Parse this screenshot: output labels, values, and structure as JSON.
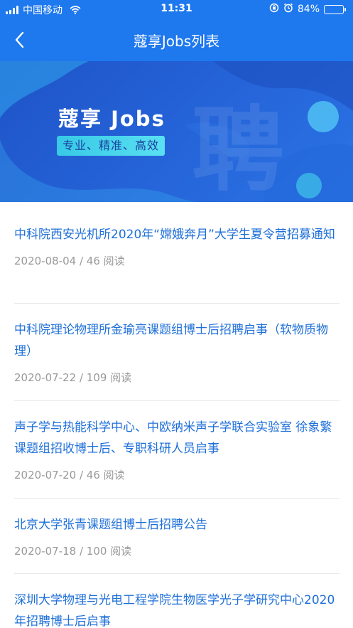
{
  "status_bar": {
    "carrier": "中国移动",
    "time": "11:31",
    "battery_percent": "84%",
    "battery_level": 0.84,
    "icons": [
      "signal-icon",
      "wifi-icon",
      "orientation-lock-icon",
      "alarm-icon",
      "battery-icon"
    ]
  },
  "nav": {
    "title": "蔻享Jobs列表",
    "back_icon": "chevron-left-icon"
  },
  "banner": {
    "title": "蔻享 Jobs",
    "tagline": "专业、精准、高效",
    "watermark": "聘"
  },
  "colors": {
    "header_bg": "#1e78ee",
    "title_blue": "#1e6fd9",
    "meta_gray": "#999999",
    "tag_cyan": "#4fd6ee"
  },
  "items": [
    {
      "title": "中科院西安光机所2020年“嫦娥奔月”大学生夏令营招募通知",
      "date": "2020-08-04",
      "views": "46 阅读"
    },
    {
      "title": "中科院理论物理所金瑜亮课题组博士后招聘启事（软物质物理）",
      "date": "2020-07-22",
      "views": "109 阅读"
    },
    {
      "title": "声子学与热能科学中心、中欧纳米声子学联合实验室 徐象繁课题组招收博士后、专职科研人员启事",
      "date": "2020-07-20",
      "views": "46 阅读"
    },
    {
      "title": "北京大学张青课题组博士后招聘公告",
      "date": "2020-07-18",
      "views": "100 阅读"
    },
    {
      "title": "深圳大学物理与光电工程学院生物医学光子学研究中心2020年招聘博士后启事",
      "date": "",
      "views": ""
    }
  ]
}
